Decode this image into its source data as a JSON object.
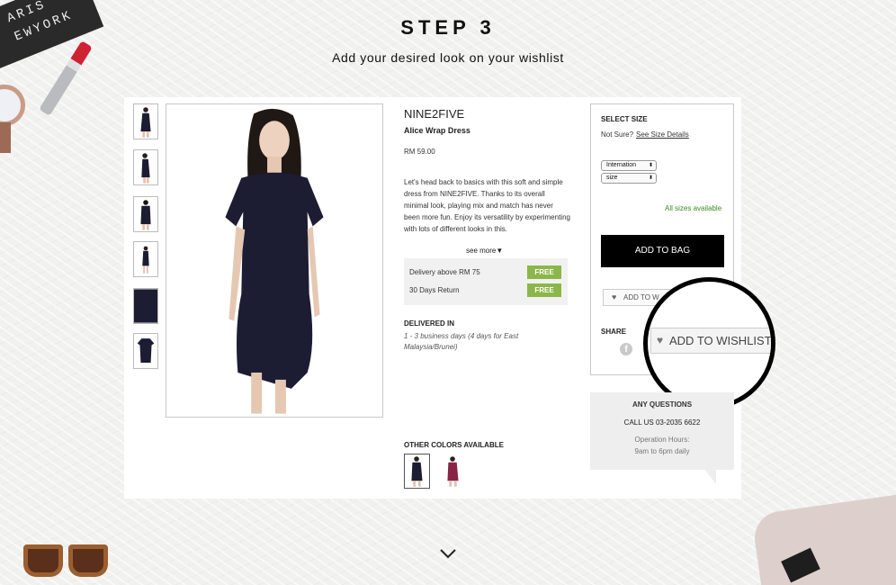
{
  "header": {
    "step": "STEP 3",
    "subtitle": "Add your desired look on your wishlist"
  },
  "decorations": {
    "card_text_line1": "ARIS",
    "card_text_line2": "EWYORK"
  },
  "product": {
    "thumbnails": [
      "front",
      "side",
      "back",
      "full",
      "fabric",
      "flat"
    ],
    "brand": "NINE2FIVE",
    "name": "Alice Wrap Dress",
    "price": "RM 59.00",
    "description": "Let's head back to basics with this soft and simple dress from NINE2FIVE. Thanks to its overall minimal look, playing mix and match has never been more fun. Enjoy its versatility by experimenting with lots of different looks in this.",
    "see_more": "see more",
    "perks": [
      {
        "label": "Delivery above RM 75",
        "badge": "FREE"
      },
      {
        "label": "30 Days Return",
        "badge": "FREE"
      }
    ],
    "delivered_label": "DELIVERED IN",
    "delivered_text": "1 - 3 business days (4 days for East Malaysia/Brunei)",
    "colors_label": "OTHER COLORS AVAILABLE",
    "colors": [
      "#1c1d33",
      "#8a2446"
    ]
  },
  "size_box": {
    "title": "SELECT SIZE",
    "not_sure": "Not Sure?",
    "size_details_link": "See Size Details",
    "region_select": "Internation",
    "size_select": "size",
    "availability": "All sizes available",
    "add_to_bag": "ADD TO BAG",
    "wishlist_small": "ADD TO W",
    "share_label": "SHARE",
    "facebook_glyph": "f"
  },
  "magnifier": {
    "wishlist_label": "ADD TO WISHLIST"
  },
  "questions": {
    "title": "ANY QUESTIONS",
    "call": "CALL US 03-2035 6622",
    "hours_label": "Operation Hours:",
    "hours": "9am to 6pm daily"
  },
  "colors": {
    "accent_green": "#8cb64a",
    "availability_green": "#3a8b1f",
    "button_black": "#000000",
    "dress_navy": "#1c1d33",
    "dress_burgundy": "#8a2446"
  },
  "icons": {
    "heart": "heart-icon",
    "down_chevron": "chevron-down-icon",
    "facebook": "facebook-icon"
  }
}
